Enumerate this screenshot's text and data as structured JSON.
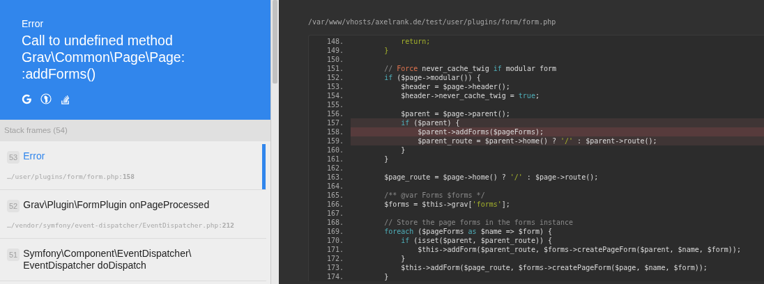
{
  "exception": {
    "type": "Error",
    "message": "Call to undefined method Grav\\Common\\Page\\Page::addForms()",
    "search_links": [
      {
        "kind": "google"
      },
      {
        "kind": "duckduckgo"
      },
      {
        "kind": "stackoverflow"
      }
    ]
  },
  "stack": {
    "header": "Stack frames (54)",
    "frames": [
      {
        "number": "53",
        "title": "Error",
        "file": "…/user/plugins/form/form.php:",
        "line": "158",
        "selected": true
      },
      {
        "number": "52",
        "title": "Grav\\Plugin\\FormPlugin onPageProcessed",
        "file": "…/vendor/symfony/event-dispatcher/EventDispatcher.php:",
        "line": "212",
        "selected": false
      },
      {
        "number": "51",
        "title": "Symfony\\Component\\EventDispatcher\\ EventDispatcher doDispatch",
        "selected": false
      }
    ]
  },
  "code": {
    "file_path": "/var/www/vhosts/axelrank.de/test/user/plugins/form/form.php",
    "lines": [
      {
        "number": "148.",
        "kind": "plain",
        "tokens": [
          {
            "kind": "str",
            "text": "            return;"
          }
        ]
      },
      {
        "number": "149.",
        "kind": "plain",
        "tokens": [
          {
            "kind": "str",
            "text": "        }"
          }
        ]
      },
      {
        "number": "150.",
        "kind": "plain"
      },
      {
        "number": "151.",
        "kind": "plain",
        "tokens": [
          {
            "kind": "com",
            "text": "        // "
          },
          {
            "kind": "tag",
            "text": "Force"
          },
          {
            "kind": "pln",
            "text": " never_cache_twig "
          },
          {
            "kind": "kw",
            "text": "if"
          },
          {
            "kind": "pln",
            "text": " modular form"
          }
        ]
      },
      {
        "number": "152.",
        "kind": "plain",
        "tokens": [
          {
            "kind": "kw",
            "text": "        if"
          },
          {
            "kind": "pln",
            "text": " ($page->modular()) {"
          }
        ]
      },
      {
        "number": "153.",
        "kind": "plain",
        "tokens": [
          {
            "kind": "pln",
            "text": "            $header = $page->header();"
          }
        ]
      },
      {
        "number": "154.",
        "kind": "plain",
        "tokens": [
          {
            "kind": "pln",
            "text": "            $header->never_cache_twig = "
          },
          {
            "kind": "kw",
            "text": "true"
          },
          {
            "kind": "pln",
            "text": ";"
          }
        ]
      },
      {
        "number": "155.",
        "kind": "plain"
      },
      {
        "number": "156.",
        "kind": "plain",
        "tokens": [
          {
            "kind": "pln",
            "text": "            $parent = $page->parent();"
          }
        ]
      },
      {
        "number": "157.",
        "kind": "context",
        "tokens": [
          {
            "kind": "kw",
            "text": "            if"
          },
          {
            "kind": "pln",
            "text": " ($parent) {"
          }
        ]
      },
      {
        "number": "158.",
        "kind": "error",
        "tokens": [
          {
            "kind": "pln",
            "text": "                $parent->addForms($pageForms);"
          }
        ]
      },
      {
        "number": "159.",
        "kind": "context",
        "tokens": [
          {
            "kind": "pln",
            "text": "                $parent_route = $parent->home() ? "
          },
          {
            "kind": "str",
            "text": "'/'"
          },
          {
            "kind": "pln",
            "text": " : $parent->route();"
          }
        ]
      },
      {
        "number": "160.",
        "kind": "plain",
        "tokens": [
          {
            "kind": "pln",
            "text": "            }"
          }
        ]
      },
      {
        "number": "161.",
        "kind": "plain",
        "tokens": [
          {
            "kind": "pln",
            "text": "        }"
          }
        ]
      },
      {
        "number": "162.",
        "kind": "plain"
      },
      {
        "number": "163.",
        "kind": "plain",
        "tokens": [
          {
            "kind": "pln",
            "text": "        $page_route = $page->home() ? "
          },
          {
            "kind": "str",
            "text": "'/'"
          },
          {
            "kind": "pln",
            "text": " : $page->route();"
          }
        ]
      },
      {
        "number": "164.",
        "kind": "plain"
      },
      {
        "number": "165.",
        "kind": "plain",
        "tokens": [
          {
            "kind": "com",
            "text": "        /** @var Forms $forms */"
          }
        ]
      },
      {
        "number": "166.",
        "kind": "plain",
        "tokens": [
          {
            "kind": "pln",
            "text": "        $forms = $this->grav["
          },
          {
            "kind": "str",
            "text": "'forms'"
          },
          {
            "kind": "pln",
            "text": "];"
          }
        ]
      },
      {
        "number": "167.",
        "kind": "plain"
      },
      {
        "number": "168.",
        "kind": "plain",
        "tokens": [
          {
            "kind": "com",
            "text": "        // Store the page forms in the forms instance"
          }
        ]
      },
      {
        "number": "169.",
        "kind": "plain",
        "tokens": [
          {
            "kind": "kw",
            "text": "        foreach"
          },
          {
            "kind": "pln",
            "text": " ($pageForms "
          },
          {
            "kind": "kw",
            "text": "as"
          },
          {
            "kind": "pln",
            "text": " $name => $form) {"
          }
        ]
      },
      {
        "number": "170.",
        "kind": "plain",
        "tokens": [
          {
            "kind": "kw",
            "text": "            if"
          },
          {
            "kind": "pln",
            "text": " (isset($parent, $parent_route)) {"
          }
        ]
      },
      {
        "number": "171.",
        "kind": "plain",
        "tokens": [
          {
            "kind": "pln",
            "text": "                $this->addForm($parent_route, $forms->createPageForm($parent, $name, $form));"
          }
        ]
      },
      {
        "number": "172.",
        "kind": "plain",
        "tokens": [
          {
            "kind": "pln",
            "text": "            }"
          }
        ]
      },
      {
        "number": "173.",
        "kind": "plain",
        "tokens": [
          {
            "kind": "pln",
            "text": "            $this->addForm($page_route, $forms->createPageForm($page, $name, $form));"
          }
        ]
      },
      {
        "number": "174.",
        "kind": "plain",
        "tokens": [
          {
            "kind": "pln",
            "text": "        }"
          }
        ]
      }
    ]
  }
}
